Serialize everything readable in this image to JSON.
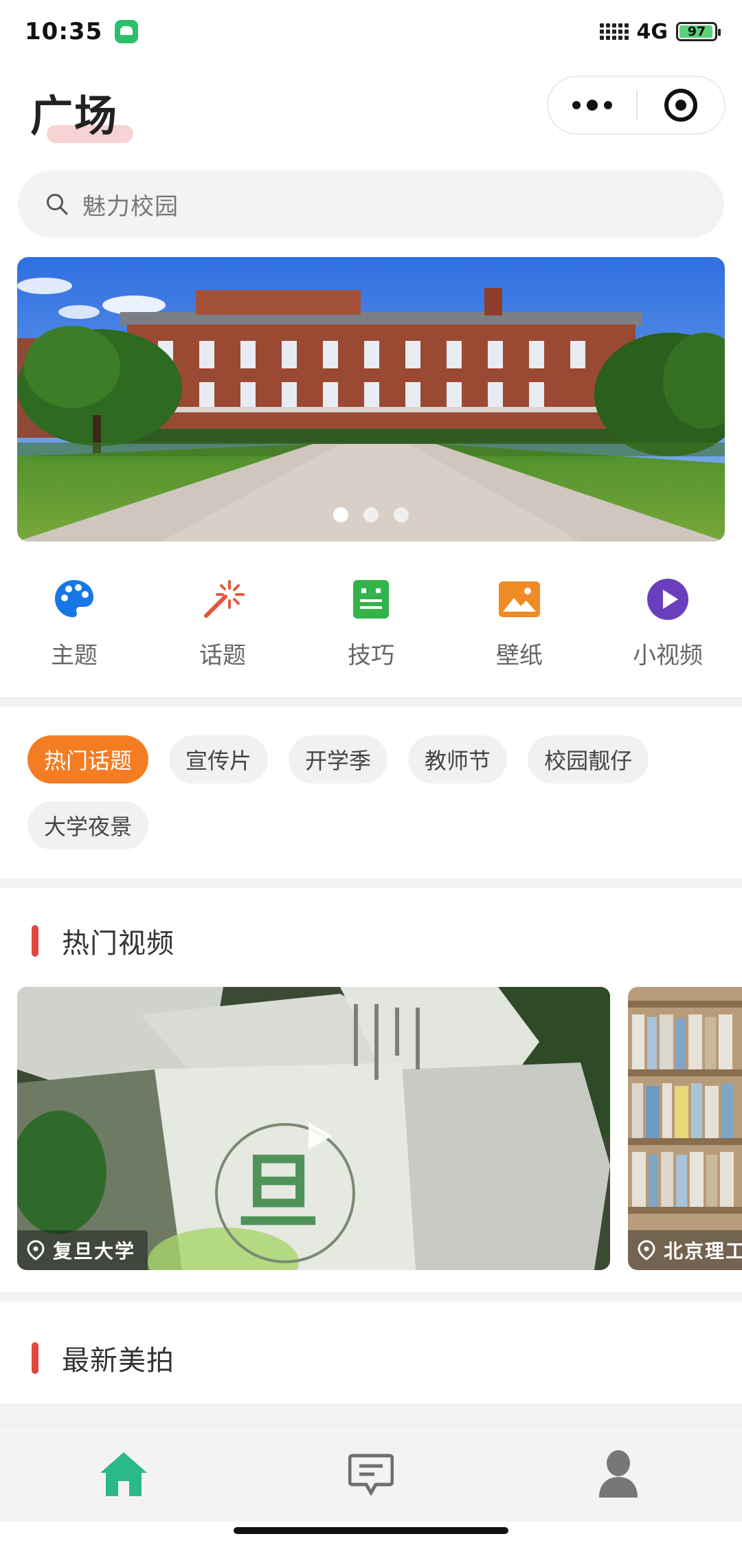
{
  "status_bar": {
    "time": "10:35",
    "network": "4G",
    "battery_level": "97",
    "battery_fraction": 0.97,
    "app_icon": "wechat-mini-program-icon"
  },
  "header": {
    "title": "广场",
    "capsule_icons": [
      "more-dots-icon",
      "target-close-icon"
    ]
  },
  "search": {
    "placeholder": "魅力校园",
    "icon": "search-icon"
  },
  "banner": {
    "image": "campus-brick-building-photo",
    "slide_count": 3,
    "active_slide": 1
  },
  "quick_entries": [
    {
      "label": "主题",
      "icon": "palette-icon",
      "color": "#1677e5"
    },
    {
      "label": "话题",
      "icon": "magic-wand-icon",
      "color": "#e4573d"
    },
    {
      "label": "技巧",
      "icon": "robot-tips-icon",
      "color": "#33b34a"
    },
    {
      "label": "壁纸",
      "icon": "picture-icon",
      "color": "#f08a24"
    },
    {
      "label": "小视频",
      "icon": "play-circle-icon",
      "color": "#6a3fbd"
    }
  ],
  "tags": [
    {
      "label": "热门话题",
      "active": true
    },
    {
      "label": "宣传片",
      "active": false
    },
    {
      "label": "开学季",
      "active": false
    },
    {
      "label": "教师节",
      "active": false
    },
    {
      "label": "校园靓仔",
      "active": false
    },
    {
      "label": "大学夜景",
      "active": false
    }
  ],
  "sections": {
    "hot_videos": {
      "title": "热门视频"
    },
    "latest_photos": {
      "title": "最新美拍"
    }
  },
  "videos": [
    {
      "location": "复旦大学"
    },
    {
      "location": "北京理工"
    }
  ],
  "tabbar": [
    {
      "name": "home",
      "icon": "home-icon",
      "active": true
    },
    {
      "name": "messages",
      "icon": "message-icon",
      "active": false
    },
    {
      "name": "profile",
      "icon": "user-icon",
      "active": false
    }
  ],
  "colors": {
    "accent_orange": "#f47c23",
    "section_bar_red": "#e2463d",
    "tab_active_green": "#2bb88a",
    "tab_inactive_gray": "#777777"
  }
}
